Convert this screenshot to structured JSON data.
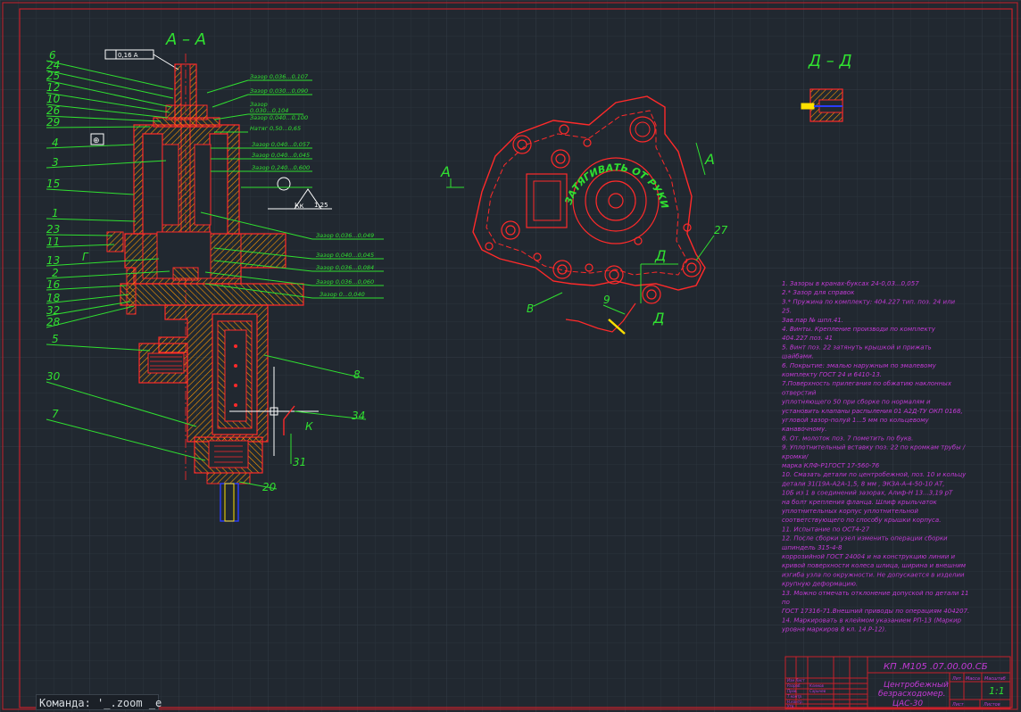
{
  "colors": {
    "background": "#212830",
    "grid": "#2b333c",
    "frame": "#c8202a",
    "outline": "#ff2a2a",
    "dimension": "#30e030",
    "hatch": "#ff9a00",
    "notes": "#c33ad6",
    "white": "#ffffff",
    "blue": "#2a3cff",
    "yellow": "#ffe000"
  },
  "views": {
    "section_aa": "А – А",
    "section_dd": "Д – Д"
  },
  "left_callouts": [
    "6",
    "24",
    "25",
    "12",
    "10",
    "26",
    "29",
    "4",
    "3",
    "15",
    "1",
    "23",
    "11",
    "13",
    "2",
    "16",
    "18",
    "32",
    "28",
    "5",
    "30",
    "7"
  ],
  "right_callouts": [
    "8",
    "34",
    "31",
    "20"
  ],
  "gap_labels": [
    "Зазор 0,036...0,107",
    "Зазор 0,030...0,090",
    "Зазор",
    "0,030...0,104",
    "Зазор 0,040...0,100",
    "Натяг 0,50...0,65",
    "Зазор 0,040...0,057",
    "Зазор 0,040...0,045",
    "Зазор 0,240...0,600",
    "Зазор 0,036...0,049",
    "Зазор 0,040...0,045",
    "Зазор 0,036...0,084",
    "Зазор 0,036...0,060",
    "Зазор 0...0,040"
  ],
  "tolerance_box": "0,16 А",
  "tolerance_mark_4": "⊕",
  "roughness_labels": [
    "Кк",
    "1,25"
  ],
  "marker_K": "К",
  "marker_G": "Г",
  "marker_V": "В",
  "plan_view": {
    "label_A": "А",
    "label_D": "Д",
    "callout_27": "27",
    "callout_9": "9",
    "arc_text": "ЗАТЯГИВАТЬ ОТ РУКИ"
  },
  "notes": [
    "1. Зазоры в кранах-буксах 24-0,03...0,057",
    "2.* Зазор для справок",
    "3.* Пружина по комплекту: 404.227 тип. поз. 24 или",
    "25.",
    "Зав.пар № шпл.41.",
    "4. Винты. Крепление производи по комплекту",
    "404.227 поз. 41",
    "5. Винт поз. 22 затянуть крышкой и прижать",
    "шайбами.",
    "6. Покрытие: эмалью наружным по эмалевому",
    "комплекту ГОСТ 24 и 6410-13.",
    "7.Поверхность прилегания по обжатию наклонных",
    "отверстий",
    "уплотняющего 50 при сборке по нормалям и",
    "установить клапаны распыления 01 А2Д-ТУ ОКП 0168,",
    "угловой зазор-полуй 1...5 мм по кольцевому",
    "канавочному.",
    "8. От. молоток поз. 7 пометить по букв.",
    "9. Уплотнительный вставку поз. 22 по кромкам трубы /",
    "кромки/",
    "марка КЛФ-Р1ГОСТ 17-560-76",
    "10. Смазать детали по центробежной, поз. 10 и кольцу",
    "детали 31(19А-А2А-1,5, 8 мм , ЭКЗА-А-4-50-10 АТ,",
    "10Б из 1 в соединений зазорах, Алиф-Н 13...3,19 рТ",
    "на болт крепления фланца. Шлиф крыльчаток",
    "уплотнительных корпус уплотнительной",
    "соответствующего по способу  крышки корпуса.",
    "11. Испытание по ОСТ4-27",
    "12. После сборки узел изменить операции сборки",
    "шпиндель 315-4-8",
    "коррозийной ГОСТ 24004 и на конструкцию линии и",
    "кривой поверхности колеса шлица, ширина и внешним",
    "изгиба узла по окружности. Не допускается в изделии",
    "крупную деформацию.",
    "13. Можно отмечать отклонение допуской по детали 11",
    "по",
    "ГОСТ 17316-71.Внешний приводы по операциям 404207.",
    "14. Маркировать в клеймом указанием РП-13 (Маркир",
    "уровня маркиров 8 кл. 14.Р-12)."
  ],
  "title_block": {
    "designation": "КП .М105 .07.00.00.СБ",
    "name_line1": "Центробежный",
    "name_line2": "безрасходомер.",
    "name_line3": "ЦАС-30",
    "scale": "1:1",
    "col_lit": "Лит",
    "col_mass": "Масса",
    "col_scale": "Масштаб",
    "sheet": "Лист",
    "sheets": "Листов",
    "rows": [
      "Изм Лист",
      "Разраб.",
      "Пров.",
      "Т.контр.",
      "Н.контр.",
      "Утв."
    ],
    "people": [
      "Климов",
      "Сарычев"
    ]
  },
  "command_line": "Команда: '_.zoom _e"
}
